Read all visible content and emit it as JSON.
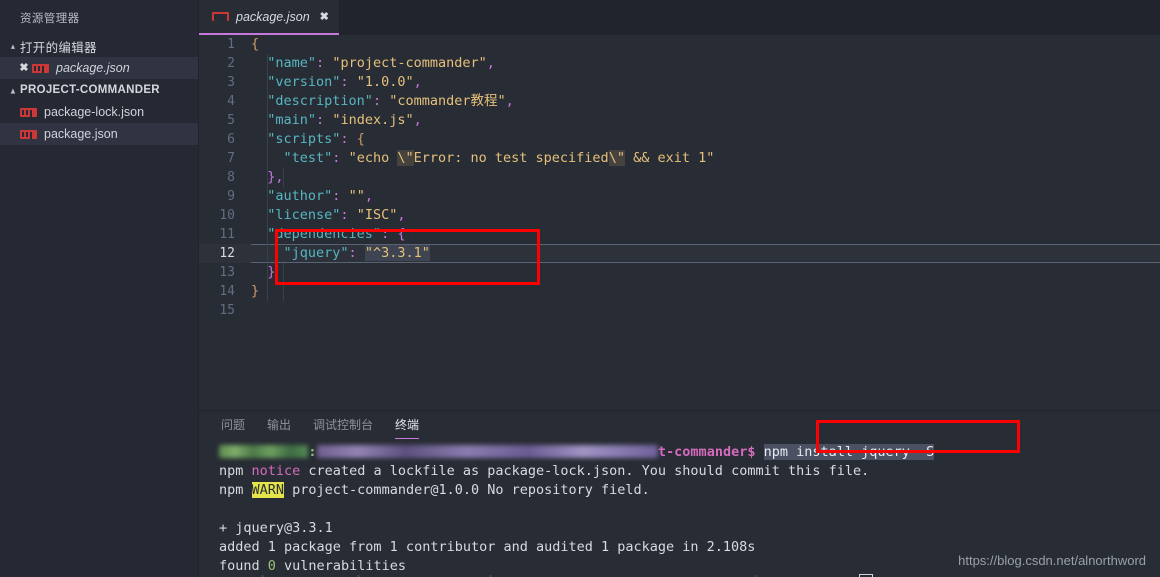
{
  "sidebar": {
    "title": "资源管理器",
    "open_editors": {
      "label": "打开的编辑器",
      "twisty": "▴",
      "items": [
        {
          "name": "package.json",
          "icon": "npm-icon",
          "close": "✖",
          "italic": true,
          "selected": true
        }
      ]
    },
    "project": {
      "label": "PROJECT-COMMANDER",
      "twisty": "▴",
      "items": [
        {
          "name": "package-lock.json",
          "icon": "npm-icon",
          "selected": false
        },
        {
          "name": "package.json",
          "icon": "npm-icon",
          "selected": true
        }
      ]
    }
  },
  "tabs": [
    {
      "label": "package.json",
      "icon": "npm-icon",
      "close": "✖",
      "active": true
    }
  ],
  "editor": {
    "language": "json",
    "current_line": 12,
    "lines": [
      {
        "n": "1",
        "text": "{"
      },
      {
        "n": "2",
        "text": "  \"name\": \"project-commander\","
      },
      {
        "n": "3",
        "text": "  \"version\": \"1.0.0\","
      },
      {
        "n": "4",
        "text": "  \"description\": \"commander教程\","
      },
      {
        "n": "5",
        "text": "  \"main\": \"index.js\","
      },
      {
        "n": "6",
        "text": "  \"scripts\": {"
      },
      {
        "n": "7",
        "text": "    \"test\": \"echo \\\"Error: no test specified\\\" && exit 1\""
      },
      {
        "n": "8",
        "text": "  },"
      },
      {
        "n": "9",
        "text": "  \"author\": \"\","
      },
      {
        "n": "10",
        "text": "  \"license\": \"ISC\","
      },
      {
        "n": "11",
        "text": "  \"dependencies\": {"
      },
      {
        "n": "12",
        "text": "    \"jquery\": \"^3.3.1\""
      },
      {
        "n": "13",
        "text": "  }"
      },
      {
        "n": "14",
        "text": "}"
      },
      {
        "n": "15",
        "text": ""
      }
    ]
  },
  "panel": {
    "tabs": [
      {
        "label": "问题",
        "active": false
      },
      {
        "label": "输出",
        "active": false
      },
      {
        "label": "调试控制台",
        "active": false
      },
      {
        "label": "终端",
        "active": true
      }
    ],
    "terminal": {
      "prompt_user_redacted": "stonecest…",
      "prompt_path_redacted": "/media/stone/3024FF51600087B46/learn/webpa…",
      "prompt_suffix": "t-commander$",
      "command": "npm install jquery -S",
      "lines": [
        "npm notice created a lockfile as package-lock.json. You should commit this file.",
        "npm WARN project-commander@1.0.0 No repository field.",
        "",
        "+ jquery@3.3.1",
        "added 1 package from 1 contributor and audited 1 package in 2.108s",
        "found 0 vulnerabilities"
      ],
      "line1_prefix": "npm ",
      "line1_notice": "notice",
      "line1_rest": " created a lockfile as package-lock.json. You should commit this file.",
      "line2_prefix": "npm ",
      "line2_warn": "WARN",
      "line2_rest": " project-commander@1.0.0 No repository field.",
      "line4": "+ jquery@3.3.1",
      "line5": "added 1 package from 1 contributor and audited 1 package in 2.108s",
      "line6_a": "found ",
      "line6_zero": "0",
      "line6_b": " vulnerabilities"
    }
  },
  "watermark": "https://blog.csdn.net/alnorthword",
  "annotations": {
    "box_editor": {
      "label": "dependencies-highlight-box"
    },
    "box_terminal": {
      "label": "install-command-highlight-box"
    },
    "color": "#ff0000"
  }
}
